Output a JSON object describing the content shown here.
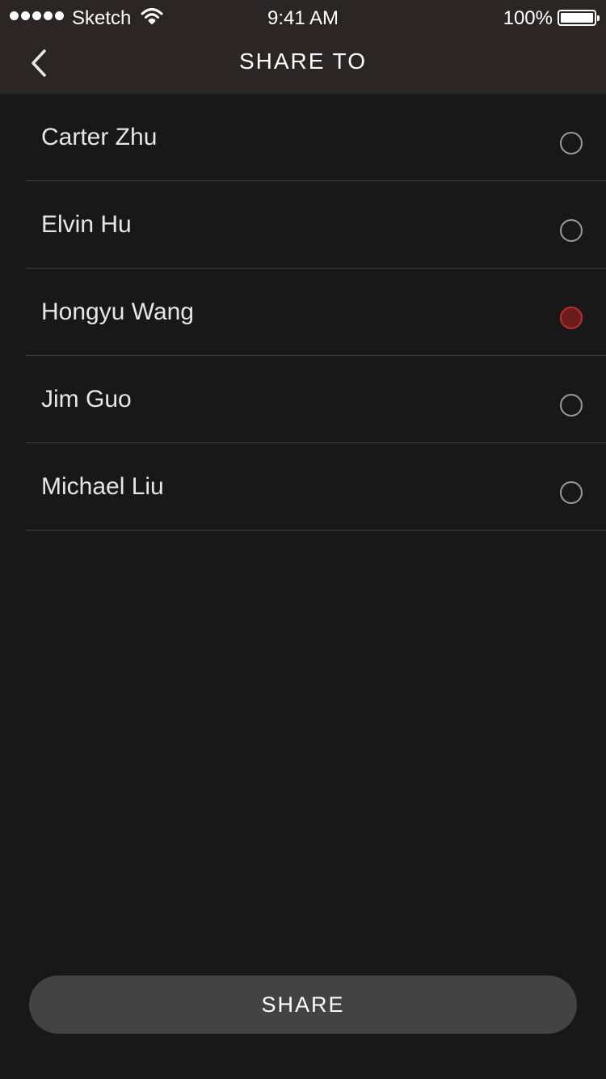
{
  "status_bar": {
    "carrier": "Sketch",
    "time": "9:41 AM",
    "battery": "100%"
  },
  "nav": {
    "title": "SHARE TO",
    "back_icon": "chevron-left-icon"
  },
  "contacts": [
    {
      "name": "Carter Zhu",
      "selected": false
    },
    {
      "name": "Elvin Hu",
      "selected": false
    },
    {
      "name": "Hongyu Wang",
      "selected": true
    },
    {
      "name": "Jim Guo",
      "selected": false
    },
    {
      "name": "Michael Liu",
      "selected": false
    }
  ],
  "share_button": {
    "label": "SHARE"
  },
  "colors": {
    "background": "#181818",
    "header": "#2b2625",
    "selected_radio": "#6d1c1c",
    "button": "#434343"
  }
}
